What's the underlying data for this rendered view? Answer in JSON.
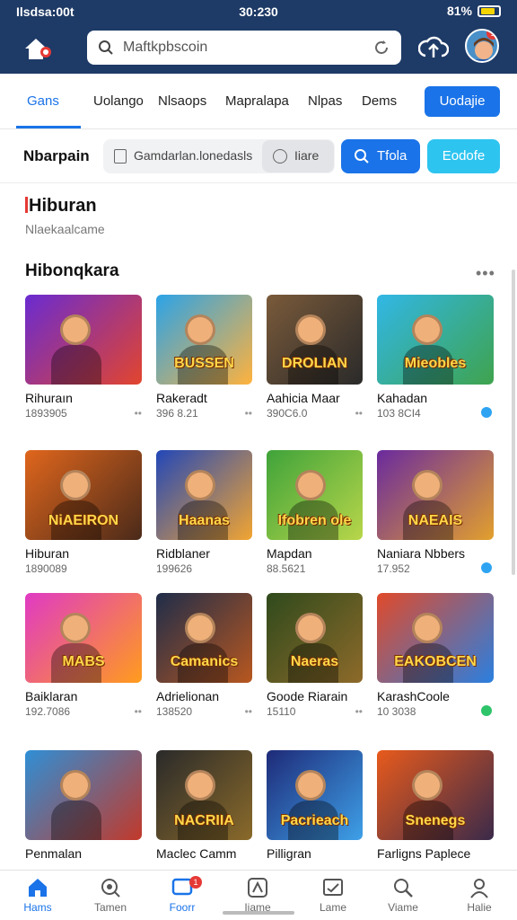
{
  "status_bar": {
    "left": "Ilsdsa:00t",
    "time": "30:230",
    "right": "81%"
  },
  "header": {
    "search_placeholder": "Maftkpbscoin",
    "avatar_badge": "1"
  },
  "tabs": {
    "items": [
      {
        "label": "Gans",
        "active": true
      },
      {
        "label": "Uolango"
      },
      {
        "label": "Nlsaops"
      },
      {
        "label": "Mapralapa"
      },
      {
        "label": "Nlpas"
      },
      {
        "label": "Dems"
      }
    ],
    "cta_label": "Uodajie"
  },
  "filter": {
    "title": "Nbarpain",
    "search_text": "Gamdarlan.lonedasls",
    "select_label": "Iiare",
    "primary_label": "Tfola",
    "secondary_label": "Eodofe"
  },
  "section": {
    "title": "Hiburan",
    "subtitle": "Nlaekaalcame",
    "list_title": "Hibonqkara",
    "more": "•••"
  },
  "games": [
    {
      "name": "Rihuraın",
      "meta": "1893905",
      "art": "",
      "bg1": "#6a2bd1",
      "bg2": "#e2452d",
      "icon": "dots"
    },
    {
      "name": "Rakeradt",
      "meta": "396 8.21",
      "art": "BUSSEN",
      "bg1": "#2ba3e8",
      "bg2": "#ffb23d",
      "icon": "dots"
    },
    {
      "name": "Aahicia Maar",
      "meta": "390C6.0",
      "art": "DROLIAN",
      "bg1": "#7a5a3a",
      "bg2": "#2a2a2a",
      "icon": "dots"
    },
    {
      "name": "Kahadan",
      "meta": "103 8CI4",
      "art": "Mieobles",
      "bg1": "#31b7e6",
      "bg2": "#3fa34d",
      "icon": "shield"
    },
    {
      "name": "Hiburan",
      "meta": "1890089",
      "art": "NiAEIRON",
      "bg1": "#e0661c",
      "bg2": "#4a2a1a",
      "icon": "none"
    },
    {
      "name": "Ridblaner",
      "meta": "199626",
      "art": "Haanas",
      "bg1": "#2247b8",
      "bg2": "#f2a531",
      "icon": "none"
    },
    {
      "name": "Mapdan",
      "meta": "88.5621",
      "art": "Ifobren ole",
      "bg1": "#3fa33a",
      "bg2": "#b8d64a",
      "icon": "none"
    },
    {
      "name": "Naniara Nbbers",
      "meta": "17.952",
      "art": "NAEAIS",
      "bg1": "#6a2a9e",
      "bg2": "#e2a02d",
      "icon": "shield"
    },
    {
      "name": "Baiklaran",
      "meta": "192.7086",
      "art": "MABS",
      "bg1": "#e03ac4",
      "bg2": "#ff9c1d",
      "icon": "dots"
    },
    {
      "name": "Adrielionan",
      "meta": "138520",
      "art": "Camanics",
      "bg1": "#1f2d4a",
      "bg2": "#b8571f",
      "icon": "dots"
    },
    {
      "name": "Goode Riarain",
      "meta": "15110",
      "art": "Naeras",
      "bg1": "#2f4a1c",
      "bg2": "#8d6a2a",
      "icon": "dots"
    },
    {
      "name": "KarashCoole",
      "meta": "10 3038",
      "art": "EAKOBCEN",
      "bg1": "#e14a2a",
      "bg2": "#2a7fe0",
      "icon": "shield-green"
    },
    {
      "name": "Penmalan",
      "meta": "",
      "art": "",
      "bg1": "#2f8fd6",
      "bg2": "#c2392a",
      "icon": "none"
    },
    {
      "name": "Maclec Camm",
      "meta": "",
      "art": "NACRIIA",
      "bg1": "#2a2a2a",
      "bg2": "#8a6a2a",
      "icon": "none"
    },
    {
      "name": "Pilligran",
      "meta": "",
      "art": "Pacrieach",
      "bg1": "#1e2a78",
      "bg2": "#3ea0e8",
      "icon": "none"
    },
    {
      "name": "Farligns Paplece",
      "meta": "",
      "art": "Snenegs",
      "bg1": "#e85a1c",
      "bg2": "#3a2a4a",
      "icon": "none"
    }
  ],
  "bottom_nav": [
    {
      "label": "Hams",
      "icon": "home-icon",
      "active": true
    },
    {
      "label": "Tamen",
      "icon": "search-icon"
    },
    {
      "label": "Foorr",
      "icon": "chat-icon",
      "active": true,
      "badge": "1"
    },
    {
      "label": "Iiame",
      "icon": "pen-icon"
    },
    {
      "label": "Lame",
      "icon": "image-icon"
    },
    {
      "label": "Viame",
      "icon": "magnifier-icon"
    },
    {
      "label": "Halie",
      "icon": "profile-icon"
    }
  ],
  "colors": {
    "primary": "#1a73e8",
    "header": "#1e3a66",
    "accent_cyan": "#2ec4f0",
    "badge": "#e53935"
  }
}
